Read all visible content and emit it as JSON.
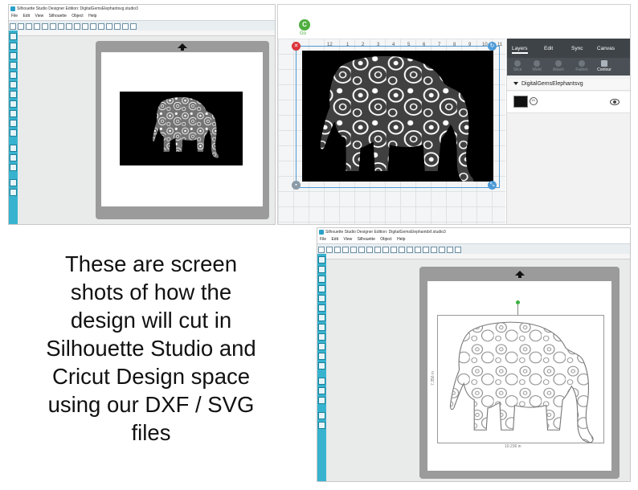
{
  "panel1": {
    "title": "Silhouette Studio Designer Edition: DigitalGemsElephantsvg.studio3",
    "menu": [
      "File",
      "Edit",
      "View",
      "Silhouette",
      "Object",
      "Help"
    ]
  },
  "panel2": {
    "go_label": "Go",
    "go_letter": "C",
    "ruler_ticks": [
      "12",
      "1",
      "2",
      "3",
      "4",
      "5",
      "6",
      "7",
      "8",
      "9",
      "10",
      "11"
    ],
    "tabs": [
      "Layers",
      "Edit",
      "Sync",
      "Canvas"
    ],
    "actions": [
      "Slice",
      "Weld",
      "Attach",
      "Flatten",
      "Contour"
    ],
    "group_name": "DigitalGemsElephantsvg"
  },
  "panel3": {
    "title": "Silhouette Studio Designer Edition: DigitalGemsElephantdxf.studio3",
    "menu": [
      "File",
      "Edit",
      "View",
      "Silhouette",
      "Object",
      "Help"
    ],
    "width_label": "10.236 in",
    "height_label": "7.356 in"
  },
  "caption": {
    "lines": [
      "These are screen",
      "shots of how the",
      "design will cut in",
      "Silhouette Studio and",
      "Cricut Design space",
      "using our DXF / SVG",
      "files"
    ]
  },
  "colors": {
    "silhouette_sidebar": "#37b3cf",
    "cricut_go": "#4fae3f",
    "cricut_panel": "#3d4347",
    "selection": "#4d9ad6",
    "danger": "#d9343a"
  }
}
